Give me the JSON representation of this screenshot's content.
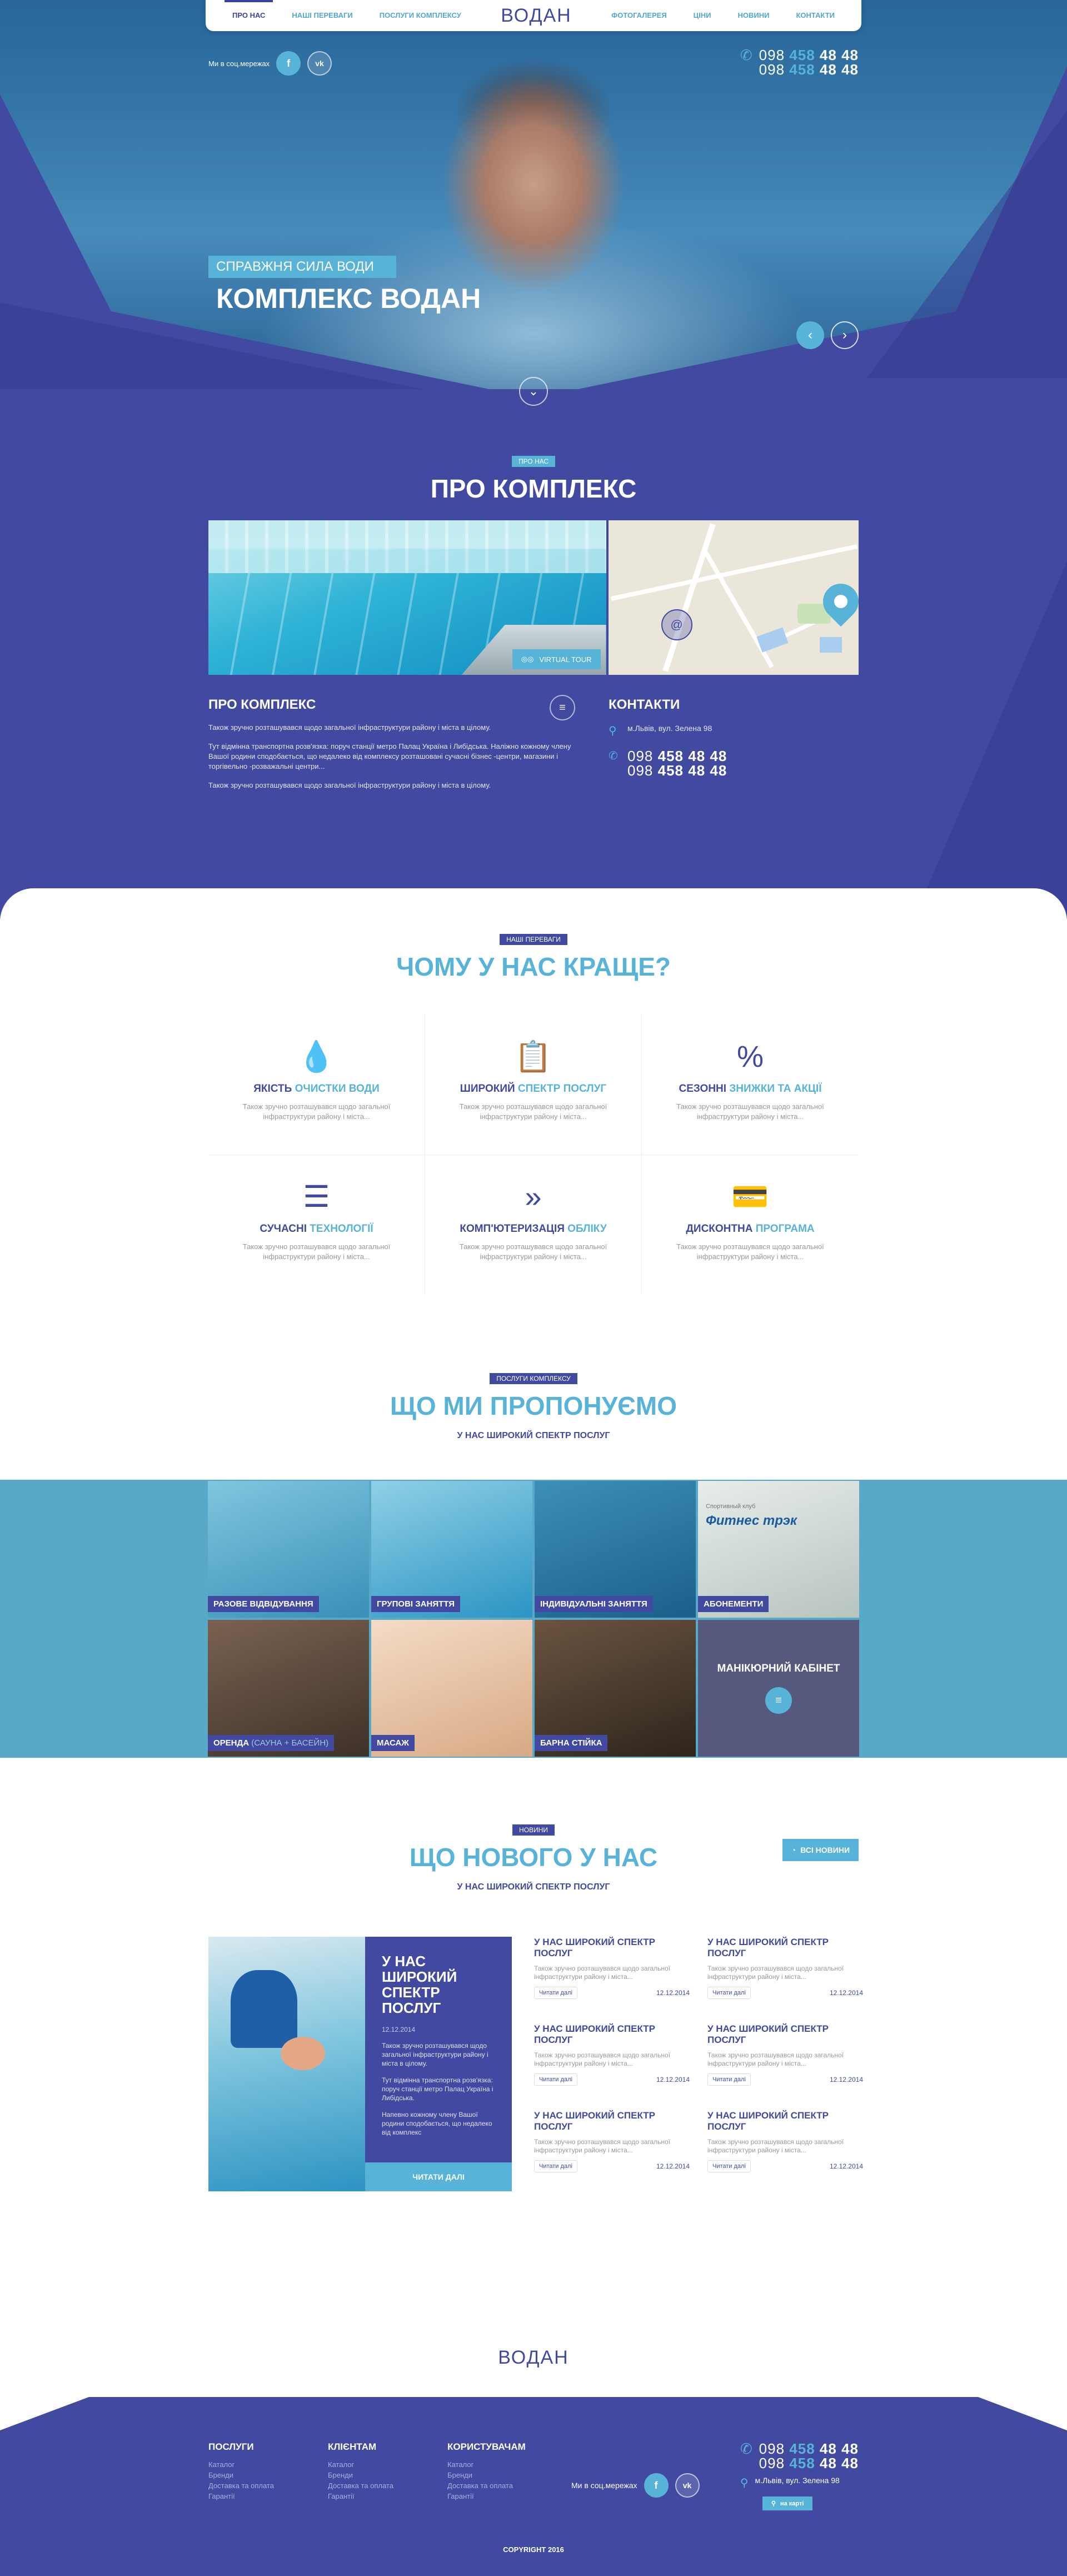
{
  "nav": {
    "left": [
      "Про нас",
      "Наші переваги",
      "Послуги комплексу"
    ],
    "right": [
      "Фотогалерея",
      "Ціни",
      "Новини",
      "Контакти"
    ],
    "logo": "ВОДАН"
  },
  "hero": {
    "social_label": "Ми в соц.мережах",
    "facebook_glyph": "f",
    "vk_glyph": "vk",
    "phones": [
      {
        "pre": "098",
        "hl": "458",
        "post": "48 48"
      },
      {
        "pre": "098",
        "hl": "458",
        "post": "48 48"
      }
    ],
    "subtitle": "Справжня сила води",
    "title": "Комплекс ВОДАН"
  },
  "about": {
    "tag": "Про нас",
    "heading": "Про комплекс",
    "virtual_tour": "Virtual tour",
    "left_title": "Про комплекс",
    "paragraphs": [
      "Також зручно розташувався щодо загальної інфраструктури району і міста в цілому.",
      "Тут відмінна транспортна розв'язка: поруч станції метро Палац Україна і Либідська. Наліжно кожному члену Вашої родини сподобається, що недалеко від комплексу розташовані сучасні бізнес -центри, магазини і торгівельно -розважальні центри...",
      "Також зручно розташувався щодо загальної інфраструктури району і міста в цілому."
    ],
    "contacts_title": "Контакти",
    "address": "м.Львів, вул. Зелена 98",
    "phones": [
      {
        "pre": "098",
        "hl": "458",
        "post": "48 48"
      },
      {
        "pre": "098",
        "hl": "458",
        "post": "48 48"
      }
    ]
  },
  "advantages": {
    "tag": "Наші переваги",
    "heading": "Чому у нас краще?",
    "items": [
      {
        "icon": "water-drop-icon",
        "glyph": "💧",
        "title_a": "Якість ",
        "title_b": "очистки води",
        "text": "Також зручно розташувався щодо загальної інфраструктури району і міста..."
      },
      {
        "icon": "clipboard-icon",
        "glyph": "📋",
        "title_a": "Широкий ",
        "title_b": "спектр послуг",
        "text": "Також зручно розташувався щодо загальної інфраструктури району і міста..."
      },
      {
        "icon": "discount-icon",
        "glyph": "%",
        "title_a": "Сезонні ",
        "title_b": "знижки та акції",
        "text": "Також зручно розташувався щодо загальної інфраструктури району і міста..."
      },
      {
        "icon": "sliders-icon",
        "glyph": "☰",
        "title_a": "Сучасні ",
        "title_b": "технології",
        "text": "Також зручно розташувався щодо загальної інфраструктури району і міста..."
      },
      {
        "icon": "chevrons-icon",
        "glyph": "»",
        "title_a": "Комп'ютеризація ",
        "title_b": "обліку",
        "text": "Також зручно розташувався щодо загальної інфраструктури району і міста..."
      },
      {
        "icon": "cards-icon",
        "glyph": "💳",
        "title_a": "Дисконтна ",
        "title_b": "програма",
        "text": "Також зручно розташувався щодо загальної інфраструктури району і міста..."
      }
    ]
  },
  "services": {
    "tag": "Послуги комплексу",
    "heading": "Що ми пропонуємо",
    "subheading": "У нас широкий спектр послуг",
    "tiles": [
      {
        "label": "Разове відвідування",
        "extra": ""
      },
      {
        "label": "Групові заняття",
        "extra": ""
      },
      {
        "label": "Індивідуальні заняття",
        "extra": ""
      },
      {
        "label": "Абонементи",
        "extra": ""
      },
      {
        "label": "Оренда ",
        "extra": "(сауна + басейн)"
      },
      {
        "label": "Масаж",
        "extra": ""
      },
      {
        "label": "Барна стійка",
        "extra": ""
      }
    ],
    "manicure": "Манікюрний кабінет",
    "fitness_sign": "Фитнес трэк",
    "sports_club": "Спортивный клуб"
  },
  "news": {
    "tag": "Новини",
    "heading": "Що нового у нас",
    "subheading": "У нас широкий спектр послуг",
    "all_news": "Всі новини",
    "main": {
      "title": "У нас широкий спектр послуг",
      "date": "12.12.2014",
      "paragraphs": [
        "Також зручно розташувався щодо загальної інфраструктури району і міста в цілому.",
        "Тут відмінна транспортна розв'язка: поруч станції метро Палац Україна і Либідська.",
        "Напевно кожному члену Вашої родини сподобається, що недалеко від комплекс"
      ],
      "read_more": "Читати далі"
    },
    "items": [
      {
        "title": "У нас широкий спектр послуг",
        "text": "Також зручно розташувався щодо загальної інфраструктури району і міста...",
        "read": "Читати далі",
        "date": "12.12.2014"
      },
      {
        "title": "У нас широкий спектр послуг",
        "text": "Також зручно розташувався щодо загальної інфраструктури району і міста...",
        "read": "Читати далі",
        "date": "12.12.2014"
      },
      {
        "title": "У нас широкий спектр послуг",
        "text": "Також зручно розташувався щодо загальної інфраструктури району і міста...",
        "read": "Читати далі",
        "date": "12.12.2014"
      },
      {
        "title": "У нас широкий спектр послуг",
        "text": "Також зручно розташувався щодо загальної інфраструктури району і міста...",
        "read": "Читати далі",
        "date": "12.12.2014"
      },
      {
        "title": "У нас широкий спектр послуг",
        "text": "Також зручно розташувався щодо загальної інфраструктури району і міста...",
        "read": "Читати далі",
        "date": "12.12.2014"
      },
      {
        "title": "У нас широкий спектр послуг",
        "text": "Також зручно розташувався щодо загальної інфраструктури району і міста...",
        "read": "Читати далі",
        "date": "12.12.2014"
      }
    ]
  },
  "footer": {
    "logo": "ВОДАН",
    "columns": [
      {
        "title": "Послуги",
        "links": [
          "Каталог",
          "Бренди",
          "Доставка та оплата",
          "Гарантії"
        ]
      },
      {
        "title": "Клієнтам",
        "links": [
          "Каталог",
          "Бренди",
          "Доставка та оплата",
          "Гарантії"
        ]
      },
      {
        "title": "Користувачам",
        "links": [
          "Каталог",
          "Бренди",
          "Доставка та оплата",
          "Гарантії"
        ]
      }
    ],
    "social_label": "Ми в соц.мережах",
    "phones": [
      {
        "pre": "098",
        "hl": "458",
        "post": "48 48"
      },
      {
        "pre": "098",
        "hl": "458",
        "post": "48 48"
      }
    ],
    "address": "м.Львів, вул. Зелена 98",
    "map_button": "на карті",
    "copyright": "Copyright 2016"
  },
  "colors": {
    "primary": "#4149a0",
    "accent": "#57b3d8",
    "services_band": "#5aa8c8"
  }
}
